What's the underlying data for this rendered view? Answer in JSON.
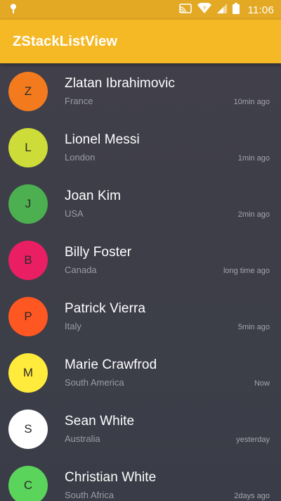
{
  "status_bar": {
    "time": "11:06"
  },
  "app_bar": {
    "title": "ZStackListView"
  },
  "colors": {
    "app_bar": "#f5b926",
    "status_bar": "#e3a824",
    "list_background": "#3b3e48"
  },
  "contacts": [
    {
      "initial": "Z",
      "name": "Zlatan Ibrahimovic",
      "location": "France",
      "time": "10min ago",
      "color": "#f47b1d"
    },
    {
      "initial": "L",
      "name": "Lionel Messi",
      "location": "London",
      "time": "1min ago",
      "color": "#cddc39"
    },
    {
      "initial": "J",
      "name": "Joan Kim",
      "location": "USA",
      "time": "2min ago",
      "color": "#4caf50"
    },
    {
      "initial": "B",
      "name": "Billy Foster",
      "location": "Canada",
      "time": "long time ago",
      "color": "#e91e63"
    },
    {
      "initial": "P",
      "name": "Patrick Vierra",
      "location": "Italy",
      "time": "5min ago",
      "color": "#ff5722"
    },
    {
      "initial": "M",
      "name": "Marie Crawfrod",
      "location": "South America",
      "time": "Now",
      "color": "#ffeb3b"
    },
    {
      "initial": "S",
      "name": "Sean White",
      "location": "Australia",
      "time": "yesterday",
      "color": "#ffffff"
    },
    {
      "initial": "C",
      "name": "Christian White",
      "location": "South Africa",
      "time": "2days ago",
      "color": "#5bd45b"
    }
  ]
}
